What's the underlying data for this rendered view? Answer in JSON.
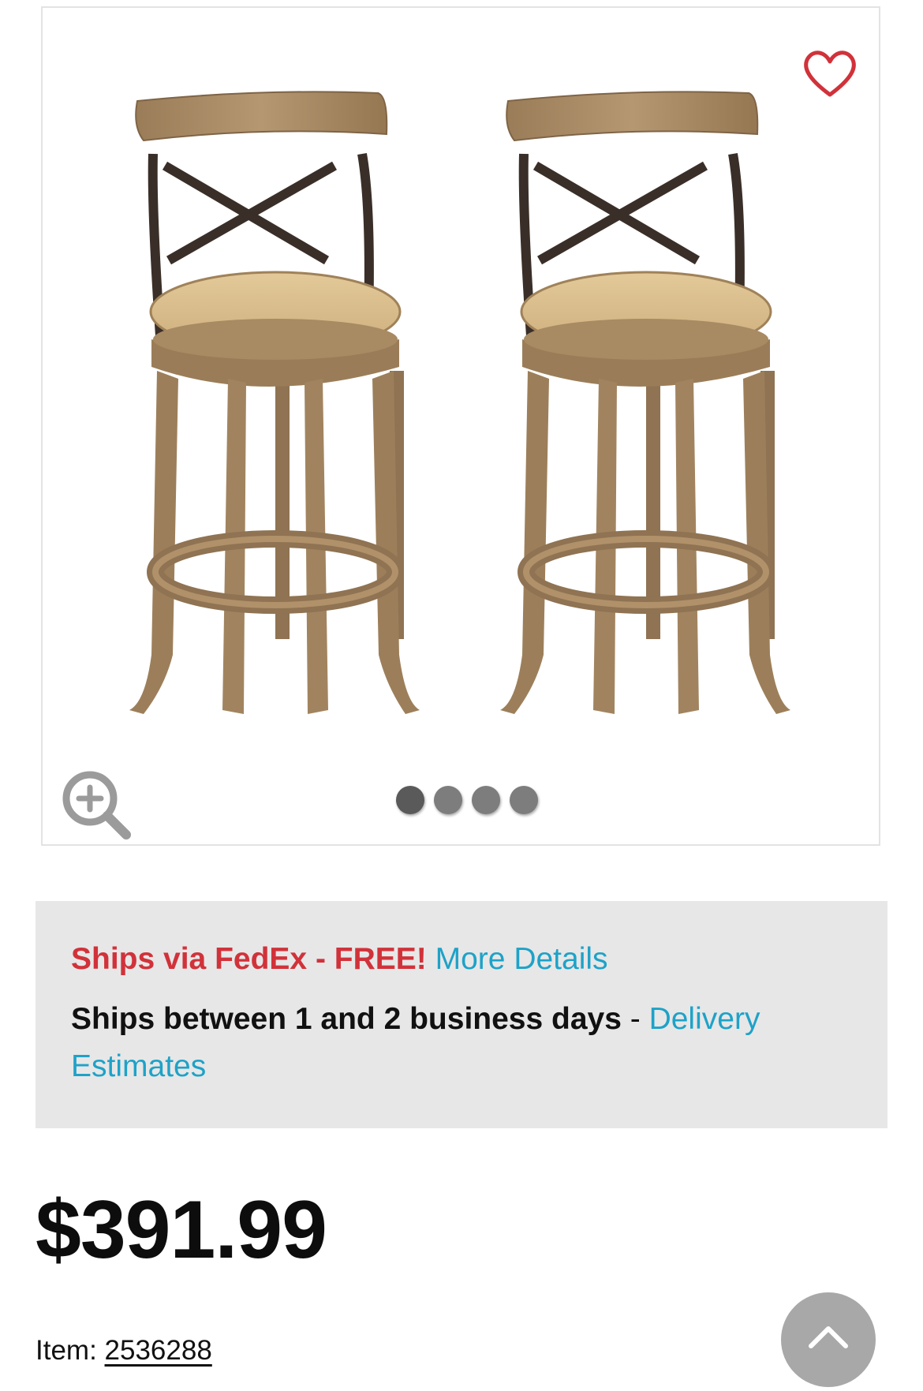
{
  "gallery": {
    "favorite_icon": "heart-outline-icon",
    "zoom_icon": "zoom-in-icon",
    "carousel_dot_count": 4,
    "active_dot": 1
  },
  "shipping": {
    "line1_prefix": "Ships via FedEx - FREE!",
    "line1_link": "More Details",
    "line2_text": "Ships between 1 and 2 business days",
    "line2_sep": " - ",
    "line2_link": "Delivery Estimates"
  },
  "product": {
    "price": "$391.99",
    "item_label": "Item:",
    "item_number": "2536288"
  },
  "colors": {
    "accent_red": "#d1323a",
    "link_blue": "#1ea2c8",
    "panel_gray": "#e7e7e7"
  },
  "back_to_top_icon": "chevron-up-icon"
}
